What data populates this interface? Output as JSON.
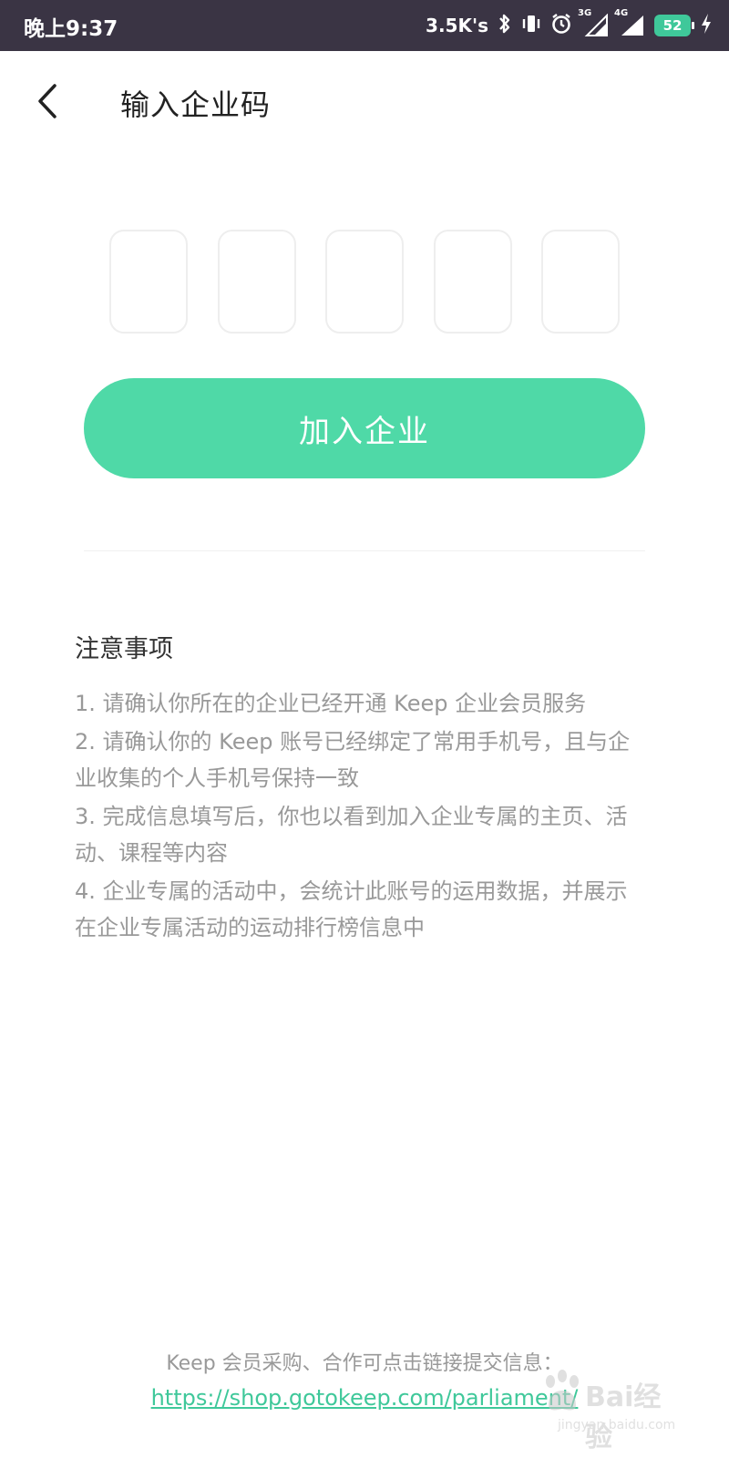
{
  "status_bar": {
    "time": "晚上9:37",
    "net_speed": "3.5K's",
    "signal_1": "3G",
    "signal_2": "4G",
    "battery": "52"
  },
  "header": {
    "title": "输入企业码"
  },
  "code_input": {
    "boxes": [
      "",
      "",
      "",
      "",
      ""
    ]
  },
  "join_button": {
    "label": "加入企业"
  },
  "notes": {
    "title": "注意事项",
    "items": [
      "1. 请确认你所在的企业已经开通 Keep 企业会员服务",
      "2. 请确认你的 Keep 账号已经绑定了常用手机号，且与企业收集的个人手机号保持一致",
      "3. 完成信息填写后，你也以看到加入企业专属的主页、活动、课程等内容",
      "4. 企业专属的活动中，会统计此账号的运用数据，并展示在企业专属活动的运动排行榜信息中"
    ]
  },
  "footer": {
    "text": "Keep 会员采购、合作可点击链接提交信息：",
    "link": "https://shop.gotokeep.com/parliament/"
  },
  "watermark": {
    "text": "Bai经验",
    "sub": "jingyan.baidu.com"
  },
  "colors": {
    "accent": "#4fd9a7",
    "status_bar": "#3a3444"
  }
}
